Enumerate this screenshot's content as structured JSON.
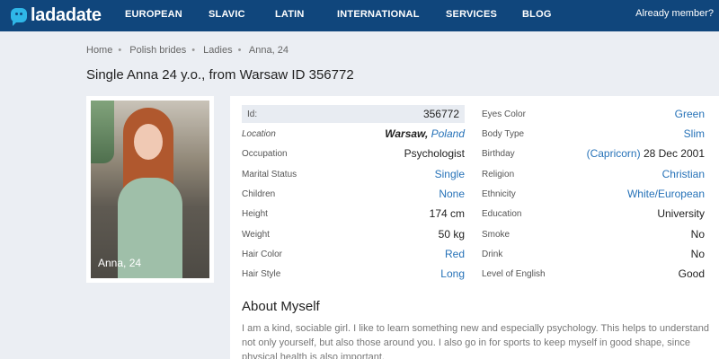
{
  "header": {
    "brand": "ladadate",
    "nav": [
      "EUROPEAN",
      "SLAVIC",
      "LATIN",
      "INTERNATIONAL",
      "SERVICES",
      "BLOG"
    ],
    "member_link": "Already member?",
    "background": "#10467c"
  },
  "breadcrumb": [
    "Home",
    "Polish brides",
    "Ladies",
    "Anna, 24"
  ],
  "title": "Single Anna 24 y.o., from Warsaw ID 356772",
  "photo": {
    "caption": "Anna, 24"
  },
  "details_left": [
    {
      "label": "Id:",
      "value": "356772"
    },
    {
      "label": "Location",
      "city": "Warsaw,",
      "country": "Poland"
    },
    {
      "label": "Occupation",
      "value": "Psychologist"
    },
    {
      "label": "Marital Status",
      "value": "Single"
    },
    {
      "label": "Children",
      "value": "None"
    },
    {
      "label": "Height",
      "value": "174 cm"
    },
    {
      "label": "Weight",
      "value": "50 kg"
    },
    {
      "label": "Hair Color",
      "value": "Red"
    },
    {
      "label": "Hair Style",
      "value": "Long"
    }
  ],
  "details_right": [
    {
      "label": "Eyes Color",
      "value": "Green"
    },
    {
      "label": "Body Type",
      "value": "Slim"
    },
    {
      "label": "Birthday",
      "sign": "(Capricorn)",
      "date": "28 Dec 2001"
    },
    {
      "label": "Religion",
      "value": "Christian"
    },
    {
      "label": "Ethnicity",
      "value": "White/European"
    },
    {
      "label": "Education",
      "value": "University"
    },
    {
      "label": "Smoke",
      "value": "No"
    },
    {
      "label": "Drink",
      "value": "No"
    },
    {
      "label": "Level of English",
      "value": "Good"
    }
  ],
  "about": {
    "title": "About Myself",
    "text": "I am a kind, sociable girl. I like to learn something new and especially psychology. This helps to understand not only yourself, but also those around you. I also go in for sports to keep myself in good shape, since physical health is also important."
  },
  "colors": {
    "link": "#2672b8",
    "page_bg": "#ebeef3"
  }
}
